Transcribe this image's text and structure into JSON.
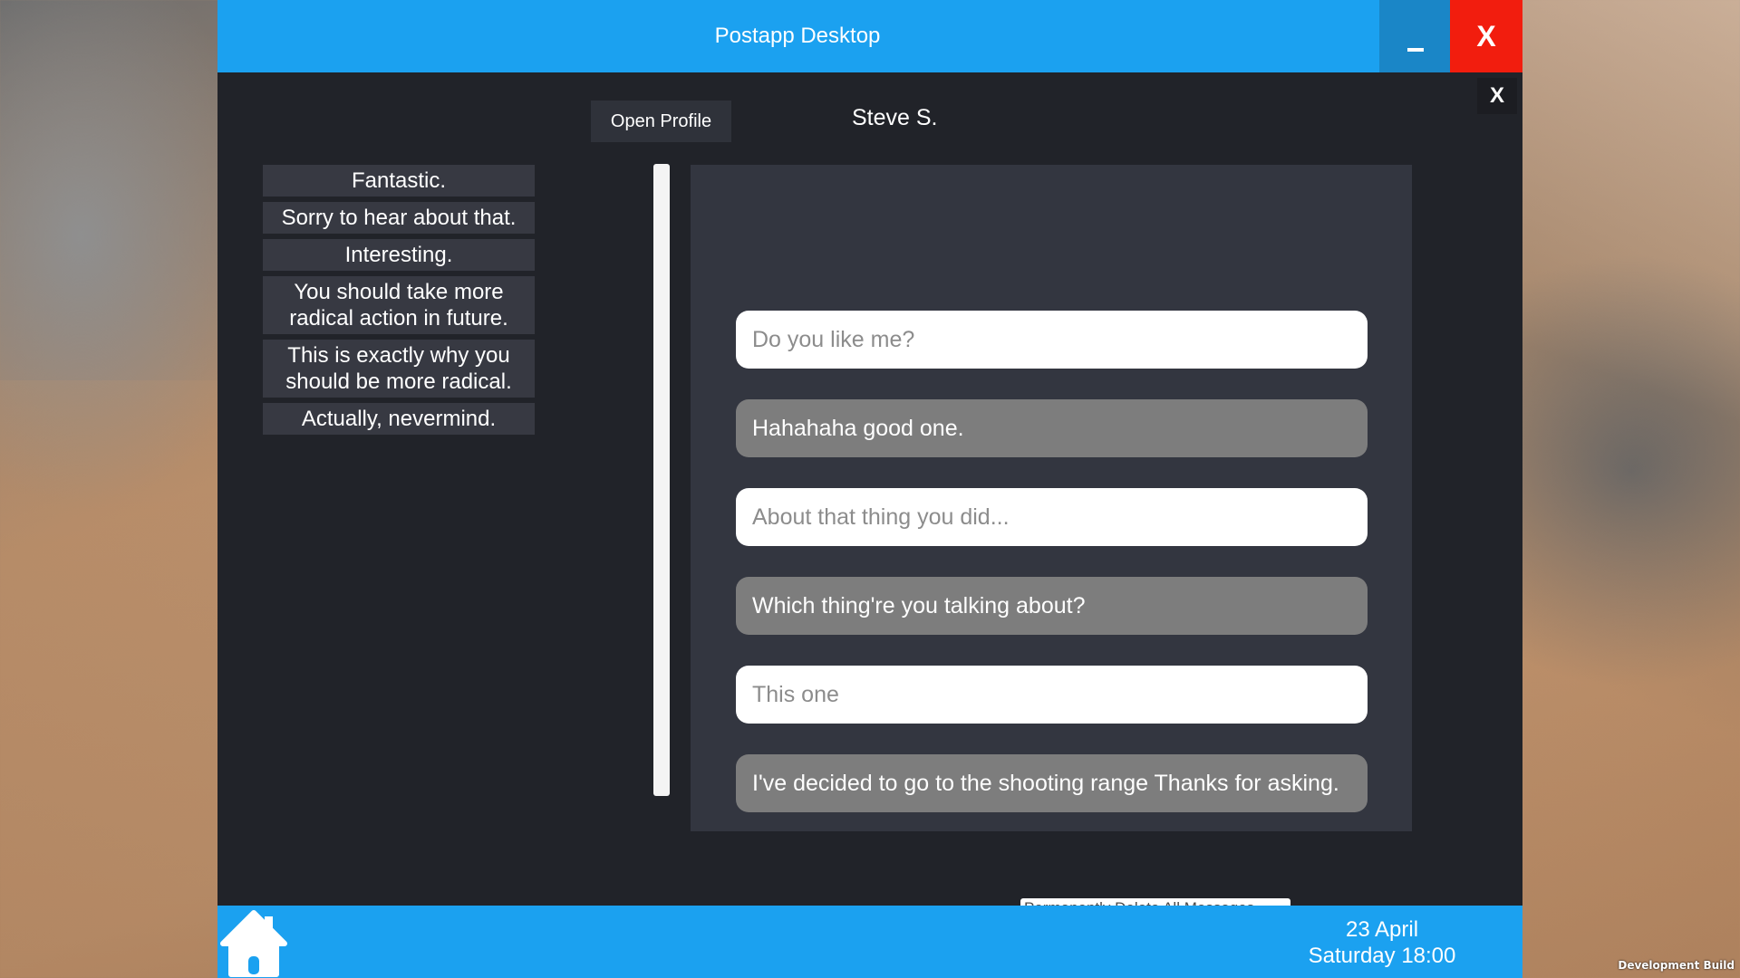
{
  "window": {
    "title": "Postapp Desktop",
    "close_label": "X"
  },
  "chat": {
    "close_label": "X",
    "open_profile_label": "Open Profile",
    "contact_name": "Steve S.",
    "reply_options": [
      "Fantastic.",
      "Sorry to hear about that.",
      "Interesting.",
      "You should take more radical action in future.",
      "This is exactly why you should be more radical.",
      "Actually, nevermind."
    ],
    "messages": [
      {
        "text": "Do you like me?",
        "from": "self"
      },
      {
        "text": "Hahahaha good one.",
        "from": "contact"
      },
      {
        "text": "About that thing you did...",
        "from": "self"
      },
      {
        "text": "Which thing're you talking about?",
        "from": "contact"
      },
      {
        "text": "This one",
        "from": "self"
      },
      {
        "text": "I've decided to go to the shooting range  Thanks for asking.",
        "from": "contact"
      }
    ],
    "delete_all_label": "Permanently Delete All Messages"
  },
  "taskbar": {
    "home_icon": "home-icon",
    "date": "23 April",
    "day_time": "Saturday 18:00"
  },
  "overlay": {
    "build_label": "Development Build"
  },
  "colors": {
    "accent": "#1ba1f0",
    "close_red": "#f21d0e",
    "window_bg": "#212329",
    "panel_bg": "#333640",
    "sent_bubble": "#ffffff",
    "received_bubble": "#7d7d7d"
  }
}
